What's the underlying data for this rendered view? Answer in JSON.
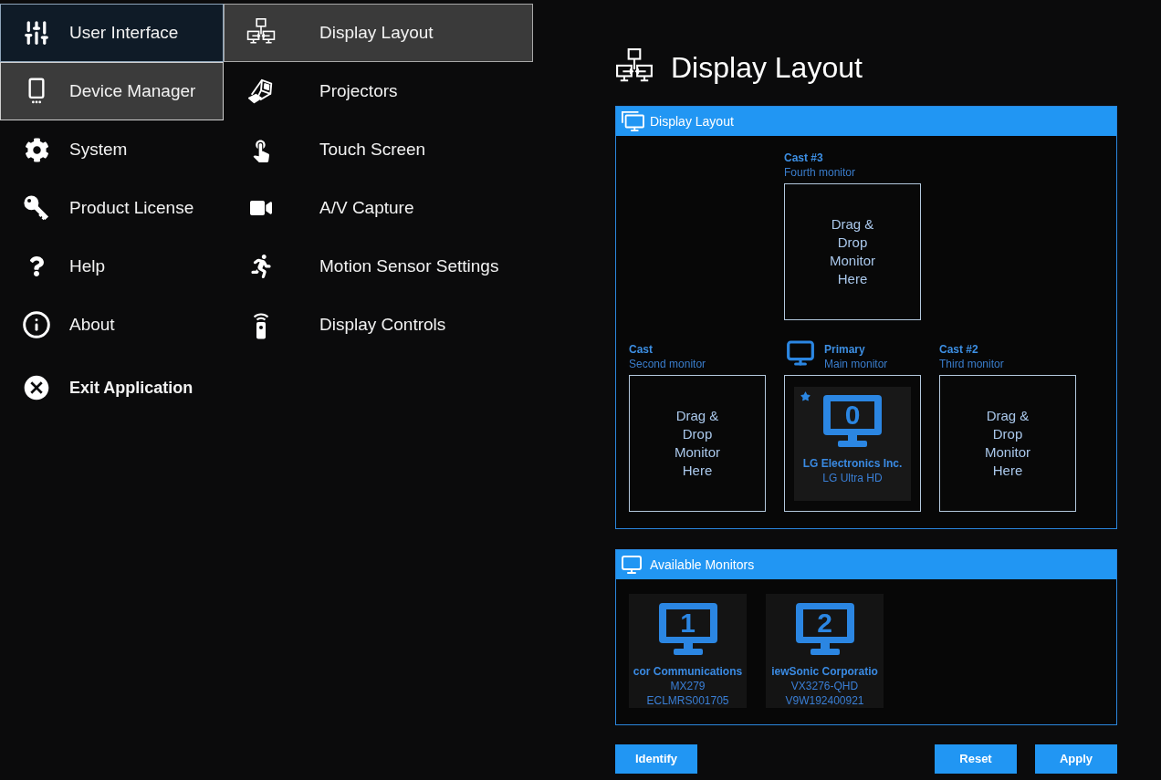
{
  "main_menu": {
    "items": [
      {
        "label": "User Interface",
        "kind": "nav",
        "selected": false,
        "hovered": true
      },
      {
        "label": "Device Manager",
        "kind": "nav",
        "selected": true,
        "hovered": false
      },
      {
        "label": "System",
        "kind": "nav",
        "selected": false,
        "hovered": false
      },
      {
        "label": "Product License",
        "kind": "nav",
        "selected": false,
        "hovered": false
      },
      {
        "label": "Help",
        "kind": "nav",
        "selected": false,
        "hovered": false
      },
      {
        "label": "About",
        "kind": "nav",
        "selected": false,
        "hovered": false
      },
      {
        "label": "Exit Application",
        "kind": "exit",
        "selected": false,
        "hovered": false
      }
    ]
  },
  "submenu": {
    "items": [
      {
        "label": "Display Layout",
        "selected": true
      },
      {
        "label": "Projectors",
        "selected": false
      },
      {
        "label": "Touch Screen",
        "selected": false
      },
      {
        "label": "A/V Capture",
        "selected": false
      },
      {
        "label": "Motion Sensor Settings",
        "selected": false
      },
      {
        "label": "Display Controls",
        "selected": false
      }
    ]
  },
  "page_title": "Display Layout",
  "layout_panel": {
    "title": "Display Layout",
    "rows": [
      {
        "cells": [
          {
            "kind": "empty"
          },
          {
            "kind": "slot",
            "label": "Cast #3",
            "sublabel": "Fourth monitor",
            "primary": false,
            "drop_hint": "Drag & Drop Monitor Here"
          },
          {
            "kind": "empty"
          }
        ]
      },
      {
        "cells": [
          {
            "kind": "slot",
            "label": "Cast",
            "sublabel": "Second monitor",
            "primary": false,
            "drop_hint": "Drag & Drop Monitor Here"
          },
          {
            "kind": "slot",
            "label": "Primary",
            "sublabel": "Main monitor",
            "primary": true,
            "monitor": {
              "number": "0",
              "starred": true,
              "name": "LG Electronics Inc.",
              "model": "LG Ultra HD"
            }
          },
          {
            "kind": "slot",
            "label": "Cast #2",
            "sublabel": "Third monitor",
            "primary": false,
            "drop_hint": "Drag & Drop Monitor Here"
          }
        ]
      }
    ]
  },
  "available_panel": {
    "title": "Available Monitors",
    "monitors": [
      {
        "number": "1",
        "starred": false,
        "name": "cor Communications",
        "model": "MX279",
        "serial": "ECLMRS001705"
      },
      {
        "number": "2",
        "starred": false,
        "name": "iewSonic Corporatio",
        "model": "VX3276-QHD",
        "serial": "V9W192400921"
      }
    ]
  },
  "actions": {
    "left": [
      {
        "label": "Identify"
      }
    ],
    "right": [
      {
        "label": "Reset"
      },
      {
        "label": "Apply"
      }
    ]
  }
}
